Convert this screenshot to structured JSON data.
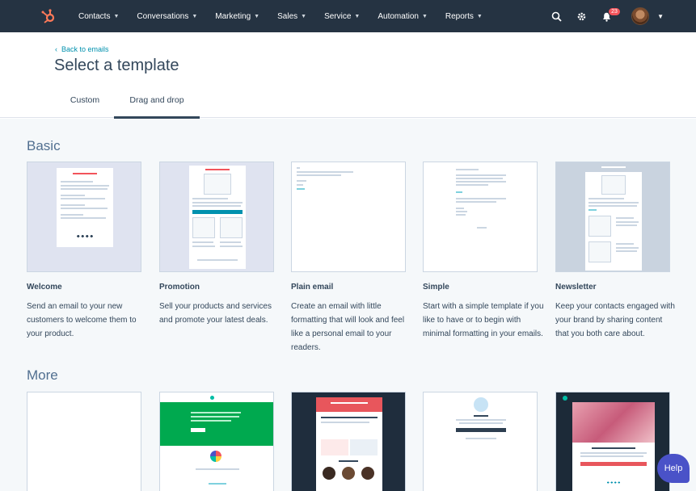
{
  "nav": {
    "items": [
      {
        "label": "Contacts"
      },
      {
        "label": "Conversations"
      },
      {
        "label": "Marketing"
      },
      {
        "label": "Sales"
      },
      {
        "label": "Service"
      },
      {
        "label": "Automation"
      },
      {
        "label": "Reports"
      }
    ],
    "notification_count": "23"
  },
  "header": {
    "back_label": "Back to emails",
    "title": "Select a template"
  },
  "tabs": [
    {
      "label": "Custom"
    },
    {
      "label": "Drag and drop"
    }
  ],
  "sections": {
    "basic_title": "Basic",
    "more_title": "More"
  },
  "templates": [
    {
      "name": "Welcome",
      "description": "Send an email to your new customers to welcome them to your product."
    },
    {
      "name": "Promotion",
      "description": "Sell your products and services and promote your latest deals."
    },
    {
      "name": "Plain email",
      "description": "Create an email with little formatting that will look and feel like a personal email to your readers."
    },
    {
      "name": "Simple",
      "description": "Start with a simple template if you like to have or to begin with minimal formatting in your emails."
    },
    {
      "name": "Newsletter",
      "description": "Keep your contacts engaged with your brand by sharing content that you both care about."
    }
  ],
  "help_label": "Help",
  "colors": {
    "nav_bg": "#253342",
    "accent_orange": "#ff7a59",
    "link": "#0091ae",
    "text": "#33475b"
  }
}
